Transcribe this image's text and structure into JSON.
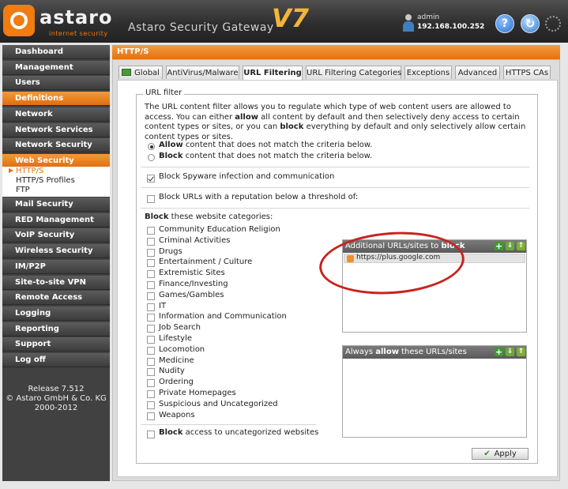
{
  "header": {
    "brand": "astaro",
    "brand_sub": "internet security",
    "app_title": "Astaro Security Gateway",
    "version": "V7",
    "user": "admin",
    "ip": "192.168.100.252",
    "help": "?",
    "reload": "↻"
  },
  "sidebar": {
    "items": [
      {
        "label": "Dashboard"
      },
      {
        "label": "Management"
      },
      {
        "label": "Users"
      },
      {
        "label": "Definitions"
      },
      {
        "label": "Network"
      },
      {
        "label": "Network Services"
      },
      {
        "label": "Network Security"
      },
      {
        "label": "Web Security"
      },
      {
        "label": "Mail Security"
      },
      {
        "label": "RED Management"
      },
      {
        "label": "VoIP Security"
      },
      {
        "label": "Wireless Security"
      },
      {
        "label": "IM/P2P"
      },
      {
        "label": "Site-to-site VPN"
      },
      {
        "label": "Remote Access"
      },
      {
        "label": "Logging"
      },
      {
        "label": "Reporting"
      },
      {
        "label": "Support"
      },
      {
        "label": "Log off"
      }
    ],
    "sub_items": [
      {
        "label": "HTTP/S",
        "active": true
      },
      {
        "label": "HTTP/S Profiles"
      },
      {
        "label": "FTP"
      }
    ],
    "release": [
      "Release 7.512",
      "© Astaro GmbH & Co. KG",
      "2000-2012"
    ]
  },
  "content": {
    "title": "HTTP/S",
    "tabs": [
      {
        "label": "Global"
      },
      {
        "label": "AntiVirus/Malware"
      },
      {
        "label": "URL Filtering",
        "active": true
      },
      {
        "label": "URL Filtering Categories"
      },
      {
        "label": "Exceptions"
      },
      {
        "label": "Advanced"
      },
      {
        "label": "HTTPS CAs"
      }
    ],
    "fieldset_legend": "URL filter",
    "intro_1": "The URL content filter allows you to regulate which type of web content users are allowed to access. You can either ",
    "intro_allow": "allow",
    "intro_2": " all content by default and then selectively deny access to certain content types or sites, or you can ",
    "intro_block": "block",
    "intro_3": " everything by default and only selectively allow certain content types or sites.",
    "radio_allow_bold": "Allow",
    "radio_allow_rest": " content that does not match the criteria below.",
    "radio_block_bold": "Block",
    "radio_block_rest": " content that does not match the criteria below.",
    "radio_selected": "allow",
    "spyware_label": "Block Spyware infection and communication",
    "spyware_checked": true,
    "reputation_label": "Block URLs with a reputation below a threshold of:",
    "reputation_checked": false,
    "categories_bold": "Block",
    "categories_rest": " these website categories:",
    "categories": [
      "Community Education Religion",
      "Criminal Activities",
      "Drugs",
      "Entertainment / Culture",
      "Extremistic Sites",
      "Finance/Investing",
      "Games/Gambles",
      "IT",
      "Information and Communication",
      "Job Search",
      "Lifestyle",
      "Locomotion",
      "Medicine",
      "Nudity",
      "Ordering",
      "Private Homepages",
      "Suspicious and Uncategorized",
      "Weapons"
    ],
    "uncategorized_bold": "Block",
    "uncategorized_rest": " access to uncategorized websites",
    "block_box_title_1": "Additional URLs/sites to ",
    "block_box_title_bold": "block",
    "block_entries": [
      "https://plus.google.com"
    ],
    "allow_box_title_1": "Always ",
    "allow_box_title_bold": "allow",
    "allow_box_title_2": " these URLs/sites",
    "apply_label": "Apply"
  },
  "colors": {
    "accent_orange": "#e0720f",
    "highlight_circle": "#c8231e"
  }
}
